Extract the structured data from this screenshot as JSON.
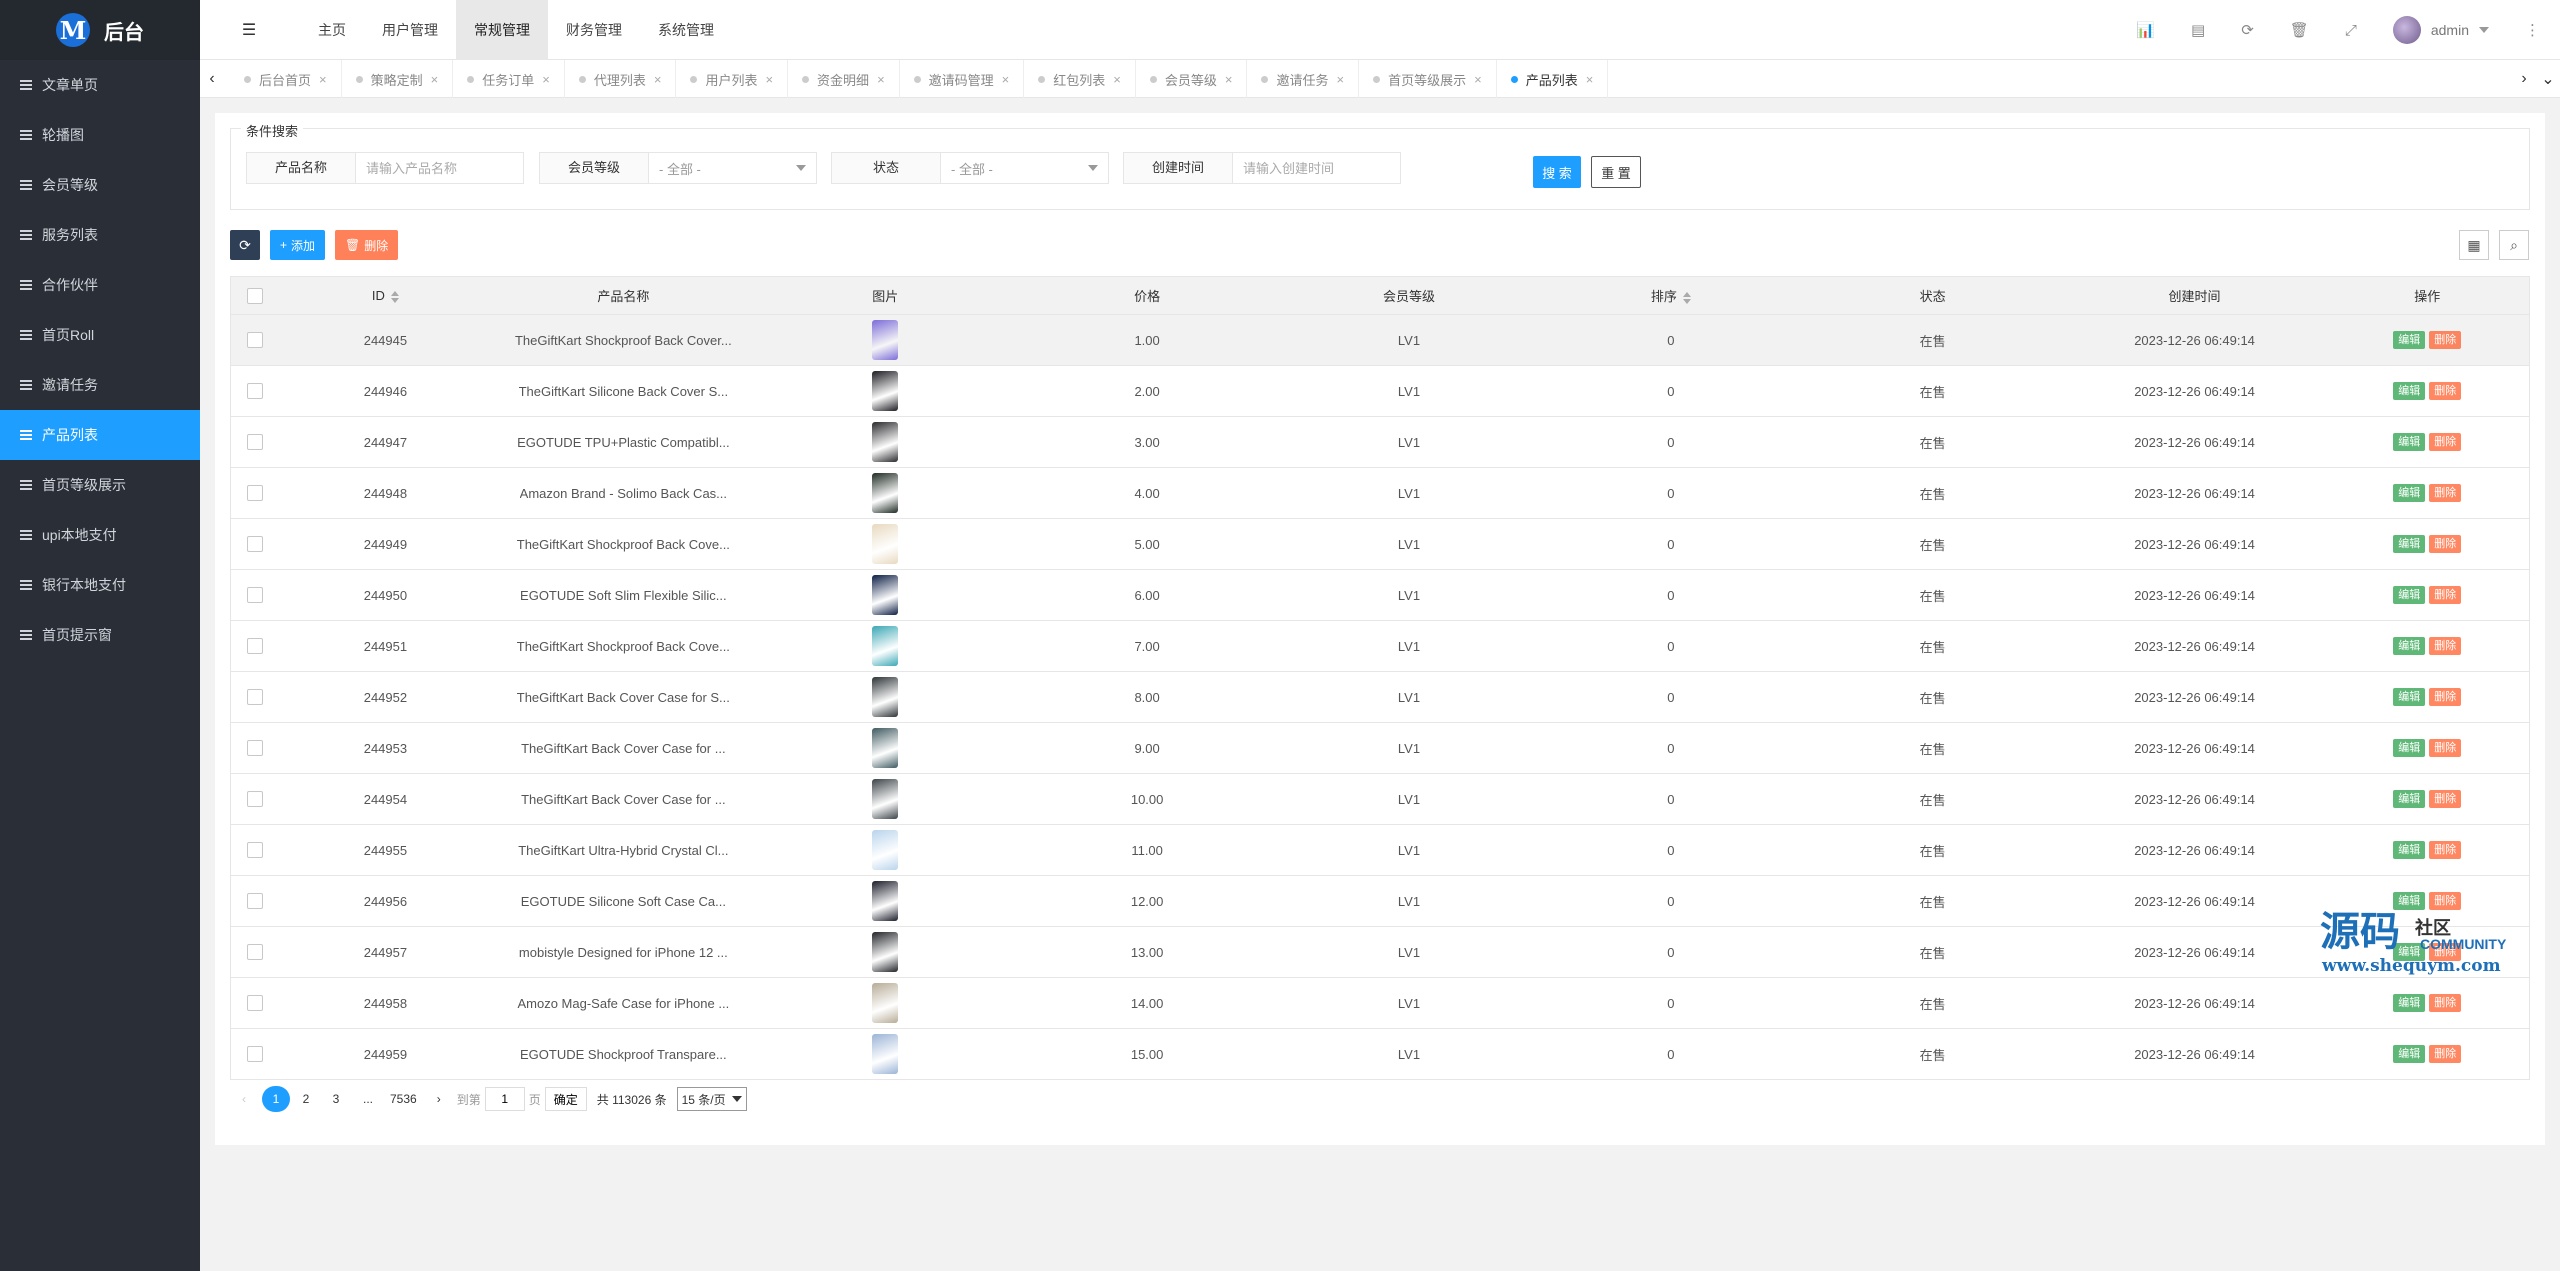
{
  "app": {
    "logo_letter": "M",
    "title": "后台"
  },
  "sidebar": {
    "items": [
      {
        "label": "文章单页",
        "active": false
      },
      {
        "label": "轮播图",
        "active": false
      },
      {
        "label": "会员等级",
        "active": false
      },
      {
        "label": "服务列表",
        "active": false
      },
      {
        "label": "合作伙伴",
        "active": false
      },
      {
        "label": "首页Roll",
        "active": false
      },
      {
        "label": "邀请任务",
        "active": false
      },
      {
        "label": "产品列表",
        "active": true
      },
      {
        "label": "首页等级展示",
        "active": false
      },
      {
        "label": "upi本地支付",
        "active": false
      },
      {
        "label": "银行本地支付",
        "active": false
      },
      {
        "label": "首页提示窗",
        "active": false
      }
    ]
  },
  "header": {
    "nav": [
      "主页",
      "用户管理",
      "常规管理",
      "财务管理",
      "系统管理"
    ],
    "active_nav": "常规管理",
    "user": "admin"
  },
  "tabs": [
    "后台首页",
    "策略定制",
    "任务订单",
    "代理列表",
    "用户列表",
    "资金明细",
    "邀请码管理",
    "红包列表",
    "会员等级",
    "邀请任务",
    "首页等级展示",
    "产品列表"
  ],
  "active_tab": "产品列表",
  "filter": {
    "legend": "条件搜索",
    "product_name_label": "产品名称",
    "product_name_placeholder": "请输入产品名称",
    "level_label": "会员等级",
    "level_value": "- 全部 -",
    "status_label": "状态",
    "status_value": "- 全部 -",
    "created_label": "创建时间",
    "created_placeholder": "请输入创建时间",
    "search_btn": "搜 索",
    "reset_btn": "重 置"
  },
  "toolbar": {
    "add": "添加",
    "delete": "删除"
  },
  "table": {
    "headers": {
      "id": "ID",
      "name": "产品名称",
      "image": "图片",
      "price": "价格",
      "level": "会员等级",
      "sort": "排序",
      "status": "状态",
      "created": "创建时间",
      "ops": "操作"
    },
    "edit_label": "编辑",
    "delete_label": "删除",
    "rows": [
      {
        "id": "244945",
        "name": "TheGiftKart Shockproof Back Cover...",
        "price": "1.00",
        "level": "LV1",
        "sort": "0",
        "status": "在售",
        "created": "2023-12-26 06:49:14",
        "thumb": "#7b6cd9"
      },
      {
        "id": "244946",
        "name": "TheGiftKart Silicone Back Cover S...",
        "price": "2.00",
        "level": "LV1",
        "sort": "0",
        "status": "在售",
        "created": "2023-12-26 06:49:14",
        "thumb": "#1c1c22"
      },
      {
        "id": "244947",
        "name": "EGOTUDE TPU+Plastic Compatibl...",
        "price": "3.00",
        "level": "LV1",
        "sort": "0",
        "status": "在售",
        "created": "2023-12-26 06:49:14",
        "thumb": "#2a2a2e"
      },
      {
        "id": "244948",
        "name": "Amazon Brand - Solimo Back Cas...",
        "price": "4.00",
        "level": "LV1",
        "sort": "0",
        "status": "在售",
        "created": "2023-12-26 06:49:14",
        "thumb": "#1f2b24"
      },
      {
        "id": "244949",
        "name": "TheGiftKart Shockproof Back Cove...",
        "price": "5.00",
        "level": "LV1",
        "sort": "0",
        "status": "在售",
        "created": "2023-12-26 06:49:14",
        "thumb": "#e8d9c0"
      },
      {
        "id": "244950",
        "name": "EGOTUDE Soft Slim Flexible Silic...",
        "price": "6.00",
        "level": "LV1",
        "sort": "0",
        "status": "在售",
        "created": "2023-12-26 06:49:14",
        "thumb": "#0d1e45"
      },
      {
        "id": "244951",
        "name": "TheGiftKart Shockproof Back Cove...",
        "price": "7.00",
        "level": "LV1",
        "sort": "0",
        "status": "在售",
        "created": "2023-12-26 06:49:14",
        "thumb": "#3aa7b5"
      },
      {
        "id": "244952",
        "name": "TheGiftKart Back Cover Case for S...",
        "price": "8.00",
        "level": "LV1",
        "sort": "0",
        "status": "在售",
        "created": "2023-12-26 06:49:14",
        "thumb": "#2d3336"
      },
      {
        "id": "244953",
        "name": "TheGiftKart Back Cover Case for ...",
        "price": "9.00",
        "level": "LV1",
        "sort": "0",
        "status": "在售",
        "created": "2023-12-26 06:49:14",
        "thumb": "#3f5a60"
      },
      {
        "id": "244954",
        "name": "TheGiftKart Back Cover Case for ...",
        "price": "10.00",
        "level": "LV1",
        "sort": "0",
        "status": "在售",
        "created": "2023-12-26 06:49:14",
        "thumb": "#3c4448"
      },
      {
        "id": "244955",
        "name": "TheGiftKart Ultra-Hybrid Crystal Cl...",
        "price": "11.00",
        "level": "LV1",
        "sort": "0",
        "status": "在售",
        "created": "2023-12-26 06:49:14",
        "thumb": "#b9d4ec"
      },
      {
        "id": "244956",
        "name": "EGOTUDE Silicone Soft Case Ca...",
        "price": "12.00",
        "level": "LV1",
        "sort": "0",
        "status": "在售",
        "created": "2023-12-26 06:49:14",
        "thumb": "#1b1d2a"
      },
      {
        "id": "244957",
        "name": "mobistyle Designed for iPhone 12 ...",
        "price": "13.00",
        "level": "LV1",
        "sort": "0",
        "status": "在售",
        "created": "2023-12-26 06:49:14",
        "thumb": "#222428"
      },
      {
        "id": "244958",
        "name": "Amozo Mag-Safe Case for iPhone ...",
        "price": "14.00",
        "level": "LV1",
        "sort": "0",
        "status": "在售",
        "created": "2023-12-26 06:49:14",
        "thumb": "#b7ab96"
      },
      {
        "id": "244959",
        "name": "EGOTUDE Shockproof Transpare...",
        "price": "15.00",
        "level": "LV1",
        "sort": "0",
        "status": "在售",
        "created": "2023-12-26 06:49:14",
        "thumb": "#9bb4d6"
      }
    ]
  },
  "pager": {
    "pages": [
      "1",
      "2",
      "3"
    ],
    "ellipsis": "...",
    "last": "7536",
    "goto_label": "到第",
    "goto_value": "1",
    "page_unit": "页",
    "confirm": "确定",
    "total": "共 113026 条",
    "per_page": "15 条/页"
  },
  "watermark": {
    "big": "源码",
    "small": "社区",
    "community": "COMMUNITY",
    "url": "www.shequym.com"
  }
}
